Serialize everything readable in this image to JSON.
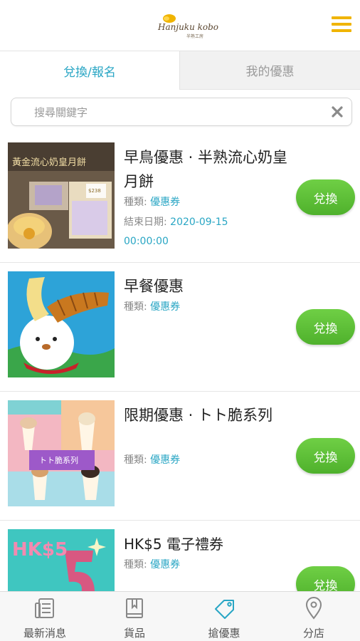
{
  "header": {
    "logo_text": "Hanjuku kobo",
    "logo_subtext": "半熟工房",
    "menu_icon": "hamburger-menu-icon"
  },
  "tabs": [
    {
      "label": "兌換/報名",
      "active": true
    },
    {
      "label": "我的優惠",
      "active": false
    }
  ],
  "search": {
    "placeholder": "搜尋關鍵字",
    "value": "",
    "clear_icon": "close-icon"
  },
  "items": [
    {
      "title": "早鳥優惠 · 半熟流心奶皇月餅",
      "type_label": "種類:",
      "type_value": "優惠券",
      "end_label": "結束日期:",
      "end_date": "2020-09-15",
      "end_time": "00:00:00",
      "thumb_text": "黃金流心奶皇月餅",
      "thumb_price": "$238",
      "button": "兌換"
    },
    {
      "title": "早餐優惠",
      "type_label": "種類:",
      "type_value": "優惠券",
      "button": "兌換"
    },
    {
      "title": "限期優惠 · トト脆系列",
      "type_label": "種類:",
      "type_value": "優惠券",
      "thumb_text": "トト脆系列",
      "button": "兌換"
    },
    {
      "title": "HK$5 電子禮券",
      "type_label": "種類:",
      "type_value": "優惠券",
      "thumb_text": "HK$5",
      "button": "兌換"
    }
  ],
  "bottom_nav": [
    {
      "label": "最新消息",
      "icon": "newspaper-icon",
      "active": false
    },
    {
      "label": "貨品",
      "icon": "book-icon",
      "active": false
    },
    {
      "label": "搶優惠",
      "icon": "tag-icon",
      "active": true
    },
    {
      "label": "分店",
      "icon": "location-pin-icon",
      "active": false
    }
  ],
  "colors": {
    "accent": "#29a6c4",
    "menu": "#f0b400",
    "button": "#58b833"
  }
}
